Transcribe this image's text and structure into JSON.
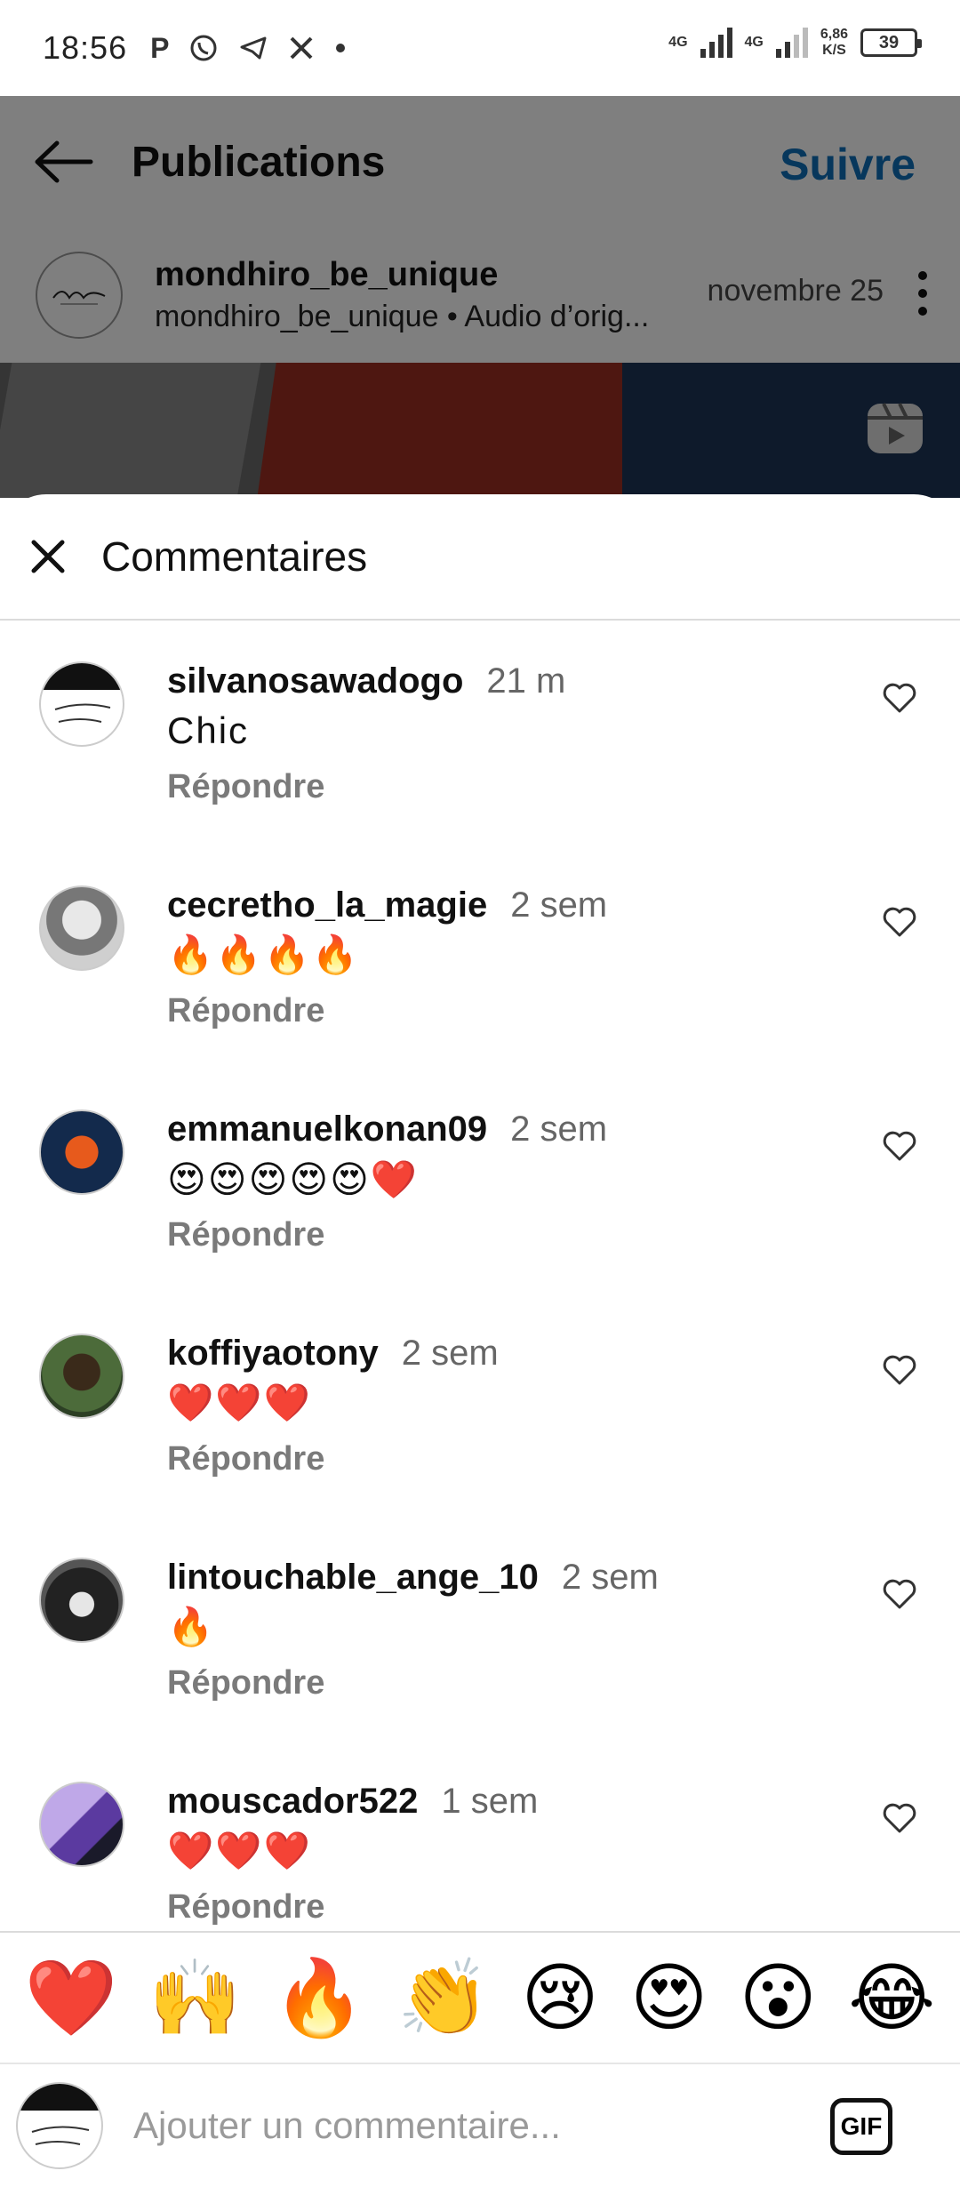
{
  "status_bar": {
    "time": "18:56",
    "left_icons": [
      "P",
      "whatsapp-icon",
      "telegram-icon",
      "x-icon",
      "dot-icon"
    ],
    "net1": "4G",
    "net2": "4G",
    "speed_value": "6,86",
    "speed_unit": "K/S",
    "battery": "39"
  },
  "header": {
    "title": "Publications",
    "follow_label": "Suivre"
  },
  "post": {
    "author": "mondhiro_be_unique",
    "subtitle": "mondhiro_be_unique  •  Audio d’orig...",
    "date": "novembre 25"
  },
  "sheet": {
    "title": "Commentaires"
  },
  "comments": [
    {
      "user": "silvanosawadogo",
      "time": "21 m",
      "text": "Chic",
      "reply": "Répondre"
    },
    {
      "user": "cecretho_la_magie",
      "time": "2 sem",
      "text": "🔥🔥🔥🔥",
      "reply": "Répondre"
    },
    {
      "user": "emmanuelkonan09",
      "time": "2 sem",
      "text": "😍😍😍😍😍❤️",
      "reply": "Répondre"
    },
    {
      "user": "koffiyaotony",
      "time": "2 sem",
      "text": "❤️❤️❤️",
      "reply": "Répondre"
    },
    {
      "user": "lintouchable_ange_10",
      "time": "2 sem",
      "text": "🔥",
      "reply": "Répondre"
    },
    {
      "user": "mouscador522",
      "time": "1 sem",
      "text": "❤️❤️❤️",
      "reply": "Répondre"
    }
  ],
  "reactions": [
    "❤️",
    "🙌",
    "🔥",
    "👏",
    "😢",
    "😍",
    "😮",
    "😂"
  ],
  "composer": {
    "placeholder": "Ajouter un commentaire...",
    "gif_label": "GIF"
  },
  "colors": {
    "accent": "#0f6fb8",
    "dim_overlay": "#000000"
  }
}
